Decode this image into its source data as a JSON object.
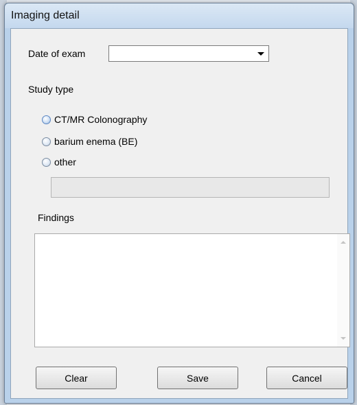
{
  "window": {
    "title": "Imaging detail"
  },
  "form": {
    "date_label": "Date of exam",
    "date_value": "",
    "study_type_label": "Study type",
    "study_options": [
      {
        "label": "CT/MR Colonography"
      },
      {
        "label": "barium enema (BE)"
      },
      {
        "label": "other"
      }
    ],
    "other_value": "",
    "findings_label": "Findings",
    "findings_value": ""
  },
  "buttons": {
    "clear": "Clear",
    "save": "Save",
    "cancel": "Cancel"
  }
}
